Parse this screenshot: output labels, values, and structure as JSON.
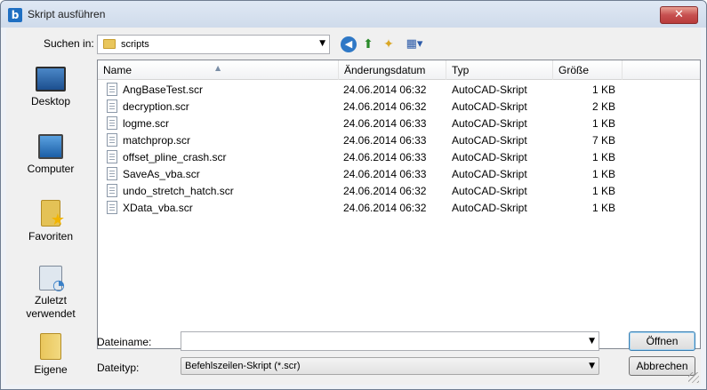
{
  "window": {
    "title": "Skript ausführen",
    "close_glyph": "✕",
    "app_icon_glyph": "b"
  },
  "lookin": {
    "label": "Suchen in:",
    "value": "scripts",
    "arrow": "▼"
  },
  "toolbar": {
    "back_icon": "back-icon",
    "up_icon": "up-folder-icon",
    "new_folder_icon": "new-folder-icon",
    "view_icon": "view-menu-icon"
  },
  "places": [
    {
      "label": "Desktop",
      "icon": "desktop-icon"
    },
    {
      "label": "Computer",
      "icon": "computer-icon"
    },
    {
      "label": "Favoriten",
      "icon": "favorites-icon"
    },
    {
      "label": "Zuletzt verwendet",
      "icon": "recent-icon"
    },
    {
      "label": "Eigene",
      "icon": "libraries-icon"
    }
  ],
  "columns": {
    "name": "Name",
    "date": "Änderungsdatum",
    "type": "Typ",
    "size": "Größe"
  },
  "files": [
    {
      "name": "AngBaseTest.scr",
      "date": "24.06.2014 06:32",
      "type": "AutoCAD-Skript",
      "size": "1 KB"
    },
    {
      "name": "decryption.scr",
      "date": "24.06.2014 06:32",
      "type": "AutoCAD-Skript",
      "size": "2 KB"
    },
    {
      "name": "logme.scr",
      "date": "24.06.2014 06:33",
      "type": "AutoCAD-Skript",
      "size": "1 KB"
    },
    {
      "name": "matchprop.scr",
      "date": "24.06.2014 06:33",
      "type": "AutoCAD-Skript",
      "size": "7 KB"
    },
    {
      "name": "offset_pline_crash.scr",
      "date": "24.06.2014 06:33",
      "type": "AutoCAD-Skript",
      "size": "1 KB"
    },
    {
      "name": "SaveAs_vba.scr",
      "date": "24.06.2014 06:33",
      "type": "AutoCAD-Skript",
      "size": "1 KB"
    },
    {
      "name": "undo_stretch_hatch.scr",
      "date": "24.06.2014 06:32",
      "type": "AutoCAD-Skript",
      "size": "1 KB"
    },
    {
      "name": "XData_vba.scr",
      "date": "24.06.2014 06:32",
      "type": "AutoCAD-Skript",
      "size": "1 KB"
    }
  ],
  "filename": {
    "label": "Dateiname:",
    "value": "",
    "arrow": "▼"
  },
  "filetype": {
    "label": "Dateityp:",
    "value": "Befehlszeilen-Skript (*.scr)",
    "arrow": "▼"
  },
  "buttons": {
    "open": "Öffnen",
    "cancel": "Abbrechen"
  },
  "colors": {
    "title_bar": "#dfe8f4",
    "close_button": "#c75050",
    "list_bg": "#ffffff",
    "dialog_bg": "#f0f0f0"
  }
}
